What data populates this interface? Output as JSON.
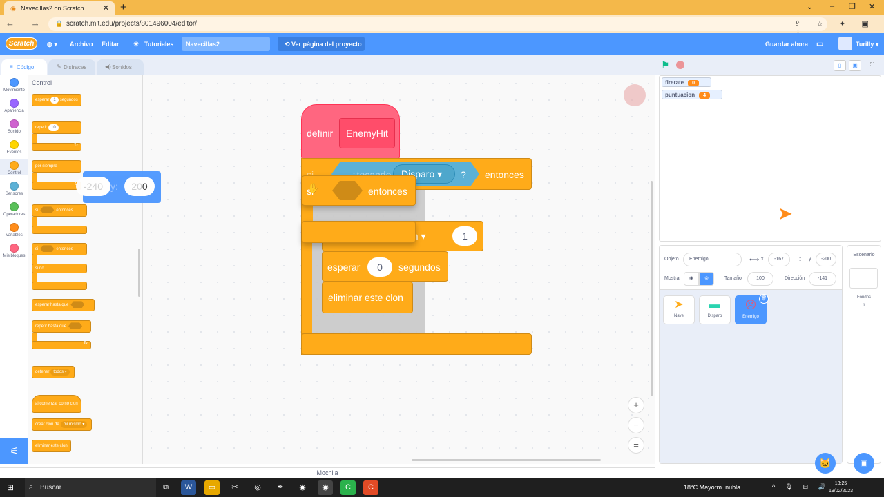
{
  "browser": {
    "tab_title": "Navecillas2 on Scratch",
    "tab_close": "✕",
    "new_tab": "+",
    "url": "scratch.mit.edu/projects/801496004/editor/",
    "nav_icons": "← → ⟳",
    "window_controls": [
      "⌄",
      "–",
      "❐",
      "✕"
    ],
    "right_icons": "⇪ ☆ ✦ ▣ ⋮"
  },
  "menubar": {
    "logo": "Scratch",
    "language_icon": "globe-icon",
    "archivo": "Archivo",
    "editar": "Editar",
    "tutoriales": "Tutoriales",
    "project_title": "Navecillas2",
    "project_page": "Ver página del proyecto",
    "guardar": "Guardar ahora",
    "user": "Turilly",
    "accent": "#4c97ff"
  },
  "editor_tabs": {
    "code": "Código",
    "costumes": "Disfraces",
    "sounds": "Sonidos"
  },
  "categories": [
    {
      "label": "Movimiento",
      "color": "#4c97ff"
    },
    {
      "label": "Apariencia",
      "color": "#9966ff"
    },
    {
      "label": "Sonido",
      "color": "#cf63cf"
    },
    {
      "label": "Eventos",
      "color": "#ffd500"
    },
    {
      "label": "Control",
      "color": "#ffab19"
    },
    {
      "label": "Sensores",
      "color": "#5cb1d6"
    },
    {
      "label": "Operadores",
      "color": "#59c059"
    },
    {
      "label": "Variables",
      "color": "#ff8c1a"
    },
    {
      "label": "Mis bloques",
      "color": "#ff6680"
    }
  ],
  "palette": {
    "title": "Control",
    "wait_pre": "esperar",
    "wait_val": "1",
    "wait_post": "segundos",
    "repeat": "repetir",
    "repeat_val": "10",
    "forever": "por siempre",
    "if": "si",
    "then": "entonces",
    "else": "si no",
    "wait_until": "esperar hasta que",
    "repeat_until": "repetir hasta que",
    "stop": "detener",
    "stop_val": "todos ▾",
    "when_clone": "al comenzar como clon",
    "create_clone": "crear clon de",
    "create_clone_val": "mí mismo ▾",
    "delete_clone": "eliminar este clon",
    "loop_arrow": "↻"
  },
  "workspace": {
    "define": "definir",
    "define_name": "EnemyHit",
    "if_label": "si",
    "touching": "¿tocando",
    "touching_target": "Disparo ▾",
    "question": "?",
    "then": "entonces",
    "clone_dd": "ón ▾",
    "clone_num": "1",
    "wait_pre": "esperar",
    "wait_num": "0",
    "wait_post": "segundos",
    "delete_clone": "eliminar este clon",
    "drag_if": "si",
    "drag_then": "entonces",
    "xy_x": "-240",
    "xy_y_label": "y:",
    "xy_y": "20",
    "xy_y_last": "0",
    "zoom_in": "+",
    "zoom_out": "−",
    "zoom_reset": "="
  },
  "stage": {
    "monitors": [
      {
        "name": "firerate",
        "value": "0"
      },
      {
        "name": "puntuacion",
        "value": "4"
      }
    ]
  },
  "sprite_info": {
    "objeto_label": "Objeto",
    "objeto_value": "Enemigo",
    "x_label": "x",
    "x_value": "-167",
    "y_label": "y",
    "y_value": "-200",
    "mostrar_label": "Mostrar",
    "tamano_label": "Tamaño",
    "tamano_value": "100",
    "direccion_label": "Dirección",
    "direccion_value": "-141"
  },
  "sprites": [
    {
      "name": "Nave"
    },
    {
      "name": "Disparo"
    },
    {
      "name": "Enemigo"
    }
  ],
  "backdrop": {
    "title": "Escenario",
    "fondos_label": "Fondos",
    "fondos_count": "1"
  },
  "backpack": "Mochila",
  "taskbar": {
    "search": "Buscar",
    "weather": "18°C  Mayorm. nubla...",
    "tray": "^ 🎙 ⊟ 🔊",
    "time": "18:25",
    "date": "19/02/2023"
  }
}
